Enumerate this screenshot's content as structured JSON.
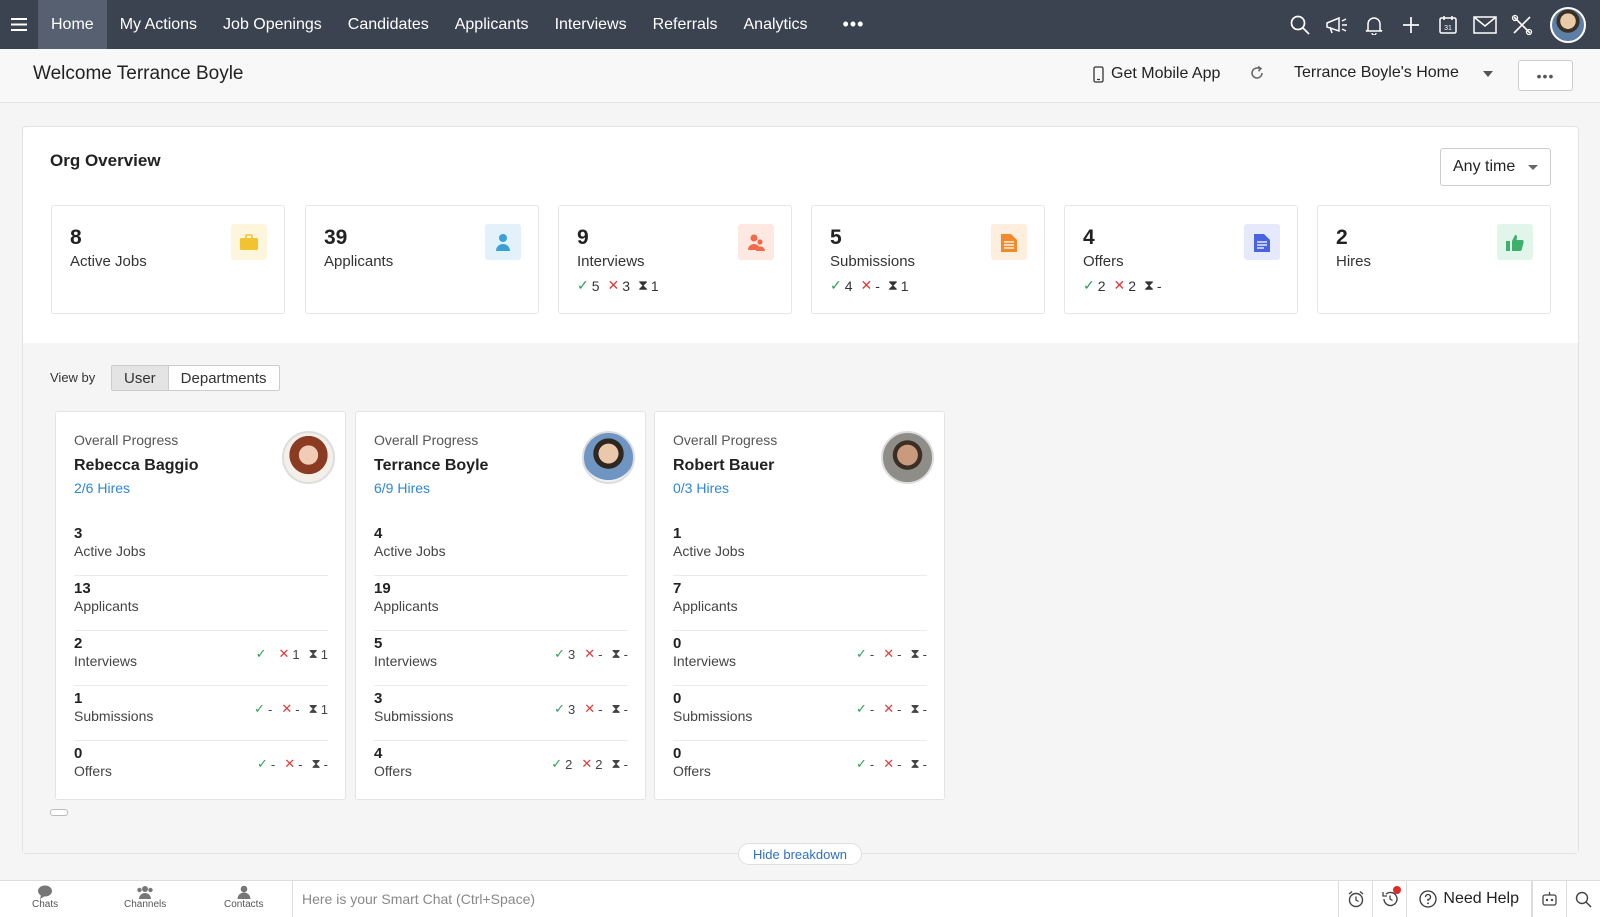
{
  "topnav": {
    "tabs": [
      {
        "label": "Home",
        "active": true
      },
      {
        "label": "My Actions"
      },
      {
        "label": "Job Openings"
      },
      {
        "label": "Candidates"
      },
      {
        "label": "Applicants"
      },
      {
        "label": "Interviews"
      },
      {
        "label": "Referrals"
      },
      {
        "label": "Analytics"
      }
    ],
    "more": "•••",
    "icons": [
      "search-icon",
      "megaphone-icon",
      "bell-icon",
      "plus-icon",
      "calendar-icon",
      "mail-icon",
      "tools-icon"
    ],
    "calendar_day": "31"
  },
  "subheader": {
    "welcome": "Welcome Terrance Boyle",
    "mobile_app": "Get Mobile App",
    "home_select": "Terrance Boyle's Home",
    "more": "•••"
  },
  "org": {
    "title": "Org Overview",
    "time_filter": "Any time",
    "stats": [
      {
        "value": "8",
        "label": "Active Jobs",
        "icon": "briefcase-icon",
        "color": "#f2c230",
        "bg": "#fdf6dd"
      },
      {
        "value": "39",
        "label": "Applicants",
        "icon": "person-icon",
        "color": "#3aa0d8",
        "bg": "#e3f2fa"
      },
      {
        "value": "9",
        "label": "Interviews",
        "icon": "people-icon",
        "color": "#ef6b4c",
        "bg": "#fde8e2",
        "check": "5",
        "cross": "3",
        "pending": "1"
      },
      {
        "value": "5",
        "label": "Submissions",
        "icon": "document-icon",
        "color": "#f08a2a",
        "bg": "#fdeede",
        "check": "4",
        "cross": "-",
        "pending": "1"
      },
      {
        "value": "4",
        "label": "Offers",
        "icon": "offer-doc-icon",
        "color": "#4a63e0",
        "bg": "#e6e9fb",
        "check": "2",
        "cross": "2",
        "pending": "-"
      },
      {
        "value": "2",
        "label": "Hires",
        "icon": "thumbs-up-icon",
        "color": "#3db06b",
        "bg": "#e2f5ea"
      }
    ]
  },
  "viewby": {
    "label": "View by",
    "options": [
      "User",
      "Departments"
    ]
  },
  "people": [
    {
      "label": "Overall Progress",
      "name": "Rebecca Baggio",
      "hires": "2/6 Hires",
      "rows": [
        {
          "num": "3",
          "label": "Active Jobs"
        },
        {
          "num": "13",
          "label": "Applicants"
        },
        {
          "num": "2",
          "label": "Interviews",
          "check": "",
          "cross": "1",
          "pending": "1"
        },
        {
          "num": "1",
          "label": "Submissions",
          "check": "-",
          "cross": "-",
          "pending": "1"
        },
        {
          "num": "0",
          "label": "Offers",
          "check": "-",
          "cross": "-",
          "pending": "-"
        }
      ]
    },
    {
      "label": "Overall Progress",
      "name": "Terrance Boyle",
      "hires": "6/9 Hires",
      "rows": [
        {
          "num": "4",
          "label": "Active Jobs"
        },
        {
          "num": "19",
          "label": "Applicants"
        },
        {
          "num": "5",
          "label": "Interviews",
          "check": "3",
          "cross": "-",
          "pending": "-"
        },
        {
          "num": "3",
          "label": "Submissions",
          "check": "3",
          "cross": "-",
          "pending": "-"
        },
        {
          "num": "4",
          "label": "Offers",
          "check": "2",
          "cross": "2",
          "pending": "-"
        }
      ]
    },
    {
      "label": "Overall Progress",
      "name": "Robert Bauer",
      "hires": "0/3 Hires",
      "rows": [
        {
          "num": "1",
          "label": "Active Jobs"
        },
        {
          "num": "7",
          "label": "Applicants"
        },
        {
          "num": "0",
          "label": "Interviews",
          "check": "-",
          "cross": "-",
          "pending": "-"
        },
        {
          "num": "0",
          "label": "Submissions",
          "check": "-",
          "cross": "-",
          "pending": "-"
        },
        {
          "num": "0",
          "label": "Offers",
          "check": "-",
          "cross": "-",
          "pending": "-"
        }
      ]
    }
  ],
  "hide_breakdown": "Hide breakdown",
  "bottombar": {
    "items": [
      {
        "label": "Chats",
        "icon": "chat-icon"
      },
      {
        "label": "Channels",
        "icon": "channels-icon"
      },
      {
        "label": "Contacts",
        "icon": "contacts-icon"
      }
    ],
    "smartchat_placeholder": "Here is your Smart Chat (Ctrl+Space)",
    "need_help": "Need Help"
  }
}
